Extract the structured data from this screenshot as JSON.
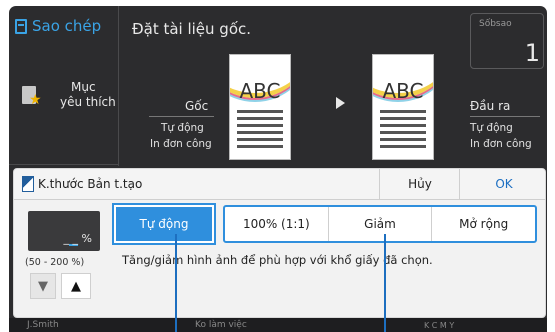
{
  "app": {
    "title": "Sao chép"
  },
  "header": {
    "instruction": "Đặt tài liệu gốc."
  },
  "copies": {
    "label": "Sốbsao",
    "value": "1"
  },
  "favorites": {
    "line1": "Mục",
    "line2": "yêu thích"
  },
  "original": {
    "label": "Gốc",
    "mode": "Tự động",
    "sides": "In đơn công",
    "page_text": "ABC"
  },
  "output": {
    "label": "Đầu ra",
    "mode": "Tự động",
    "sides": "In đơn công",
    "page_text": "ABC"
  },
  "dialog": {
    "title": "K.thước Bản t.tạo",
    "cancel": "Hủy",
    "ok": "OK",
    "ratio_value": "_ _ %",
    "range": "(50 - 200 %)",
    "down": "▼",
    "up": "▲",
    "option_auto": "Tự động",
    "options": [
      "100% (1:1)",
      "Giảm",
      "Mở rộng"
    ],
    "description": "Tăng/giảm hình ảnh để phù hợp với khổ giấy đã chọn."
  },
  "status_bar": {
    "user": "J.Smith",
    "status": "Ko làm việc",
    "toner": "K  C  M  Y"
  },
  "colors": {
    "accent": "#2f8fdd",
    "header_bg": "#2c2c2e",
    "title_blue": "#3aa3e5"
  }
}
